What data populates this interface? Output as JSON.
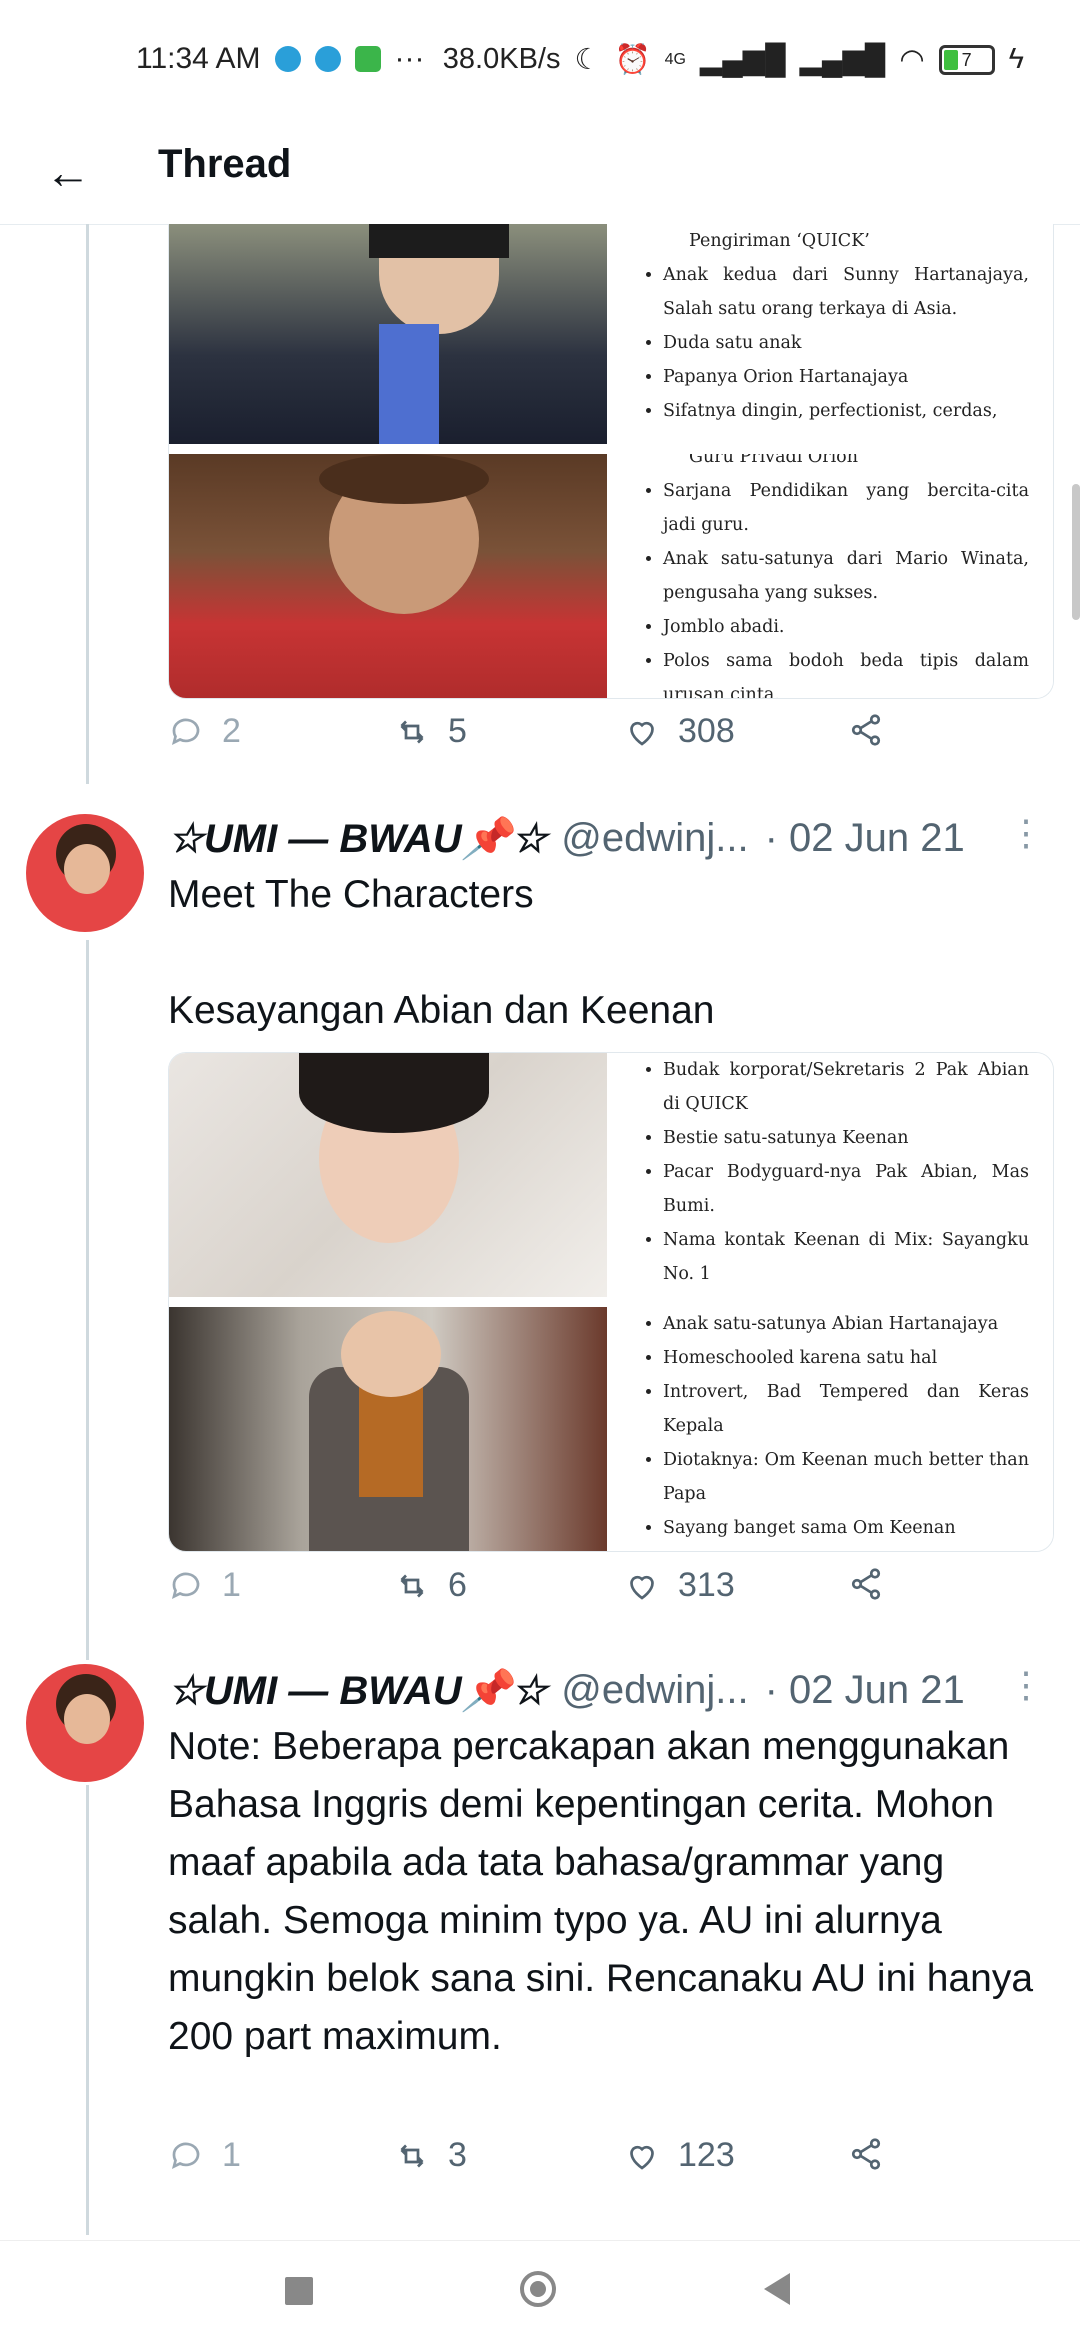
{
  "status_bar": {
    "time": "11:34 AM",
    "app_icons": [
      "telegram-icon",
      "telegram-icon",
      "green-app-icon"
    ],
    "more": "···",
    "speed": "38.0KB/s",
    "network": "4G",
    "battery": "7"
  },
  "header": {
    "title": "Thread",
    "back_icon": "back-arrow-icon"
  },
  "tweet0": {
    "card_top_bio": [
      "Pengiriman ‘QUICK’",
      "Anak kedua dari Sunny Hartanajaya, Salah satu orang terkaya di Asia.",
      "Duda satu anak",
      "Papanya Orion Hartanajaya",
      "Sifatnya dingin, perfectionist, cerdas,"
    ],
    "card_bottom_bio": [
      "Guru Privadi Orion",
      "Sarjana Pendidikan yang bercita-cita jadi guru.",
      "Anak satu-satunya dari Mario Winata, pengusaha yang sukses.",
      "Jomblo abadi.",
      "Polos sama bodoh beda tipis dalam urusan cinta."
    ],
    "replies": "2",
    "retweets": "5",
    "likes": "308"
  },
  "tweet1": {
    "name": "☆UMI — BWAU📌☆",
    "handle": "@edwinj...",
    "date": "· 02 Jun 21",
    "text": "Meet The Characters\n\nKesayangan Abian dan Keenan",
    "card_top_bio": [
      "Budak korporat/Sekretaris 2 Pak Abian di QUICK",
      "Bestie satu-satunya Keenan",
      "Pacar Bodyguard-nya Pak Abian, Mas Bumi.",
      "Nama kontak Keenan di Mix: Sayangku No. 1"
    ],
    "card_bottom_bio": [
      "Anak satu-satunya Abian Hartanajaya",
      "Homeschooled karena satu hal",
      "Introvert, Bad Tempered dan Keras Kepala",
      "Diotaknya: Om Keenan much better than Papa",
      "Sayang banget sama Om Keenan"
    ],
    "replies": "1",
    "retweets": "6",
    "likes": "313"
  },
  "tweet2": {
    "name": "☆UMI — BWAU📌☆",
    "handle": "@edwinj...",
    "date": "· 02 Jun 21",
    "text": "Note: Beberapa percakapan akan menggunakan Bahasa Inggris demi kepentingan cerita. Mohon maaf apabila ada tata bahasa/grammar yang salah. Semoga minim typo ya. AU ini alurnya mungkin belok sana sini. Rencanaku AU ini hanya 200 part maximum.",
    "replies": "1",
    "retweets": "3",
    "likes": "123"
  },
  "colors": {
    "accent": "#1d9bf0",
    "muted": "#536471",
    "thread_line": "#cfd9de"
  }
}
